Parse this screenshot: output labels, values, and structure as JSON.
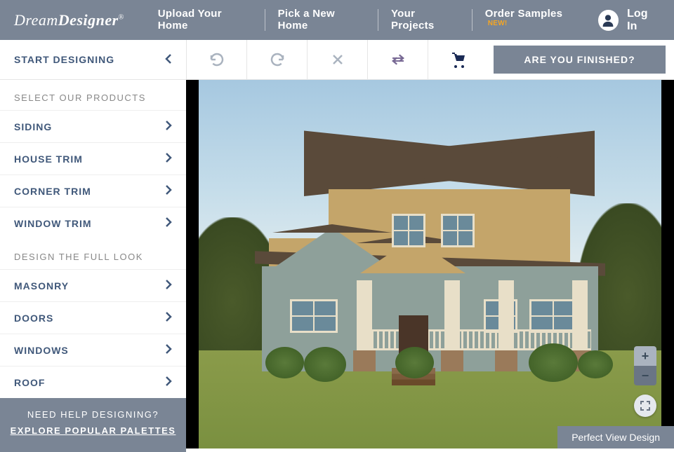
{
  "header": {
    "logo_pre": "Dream",
    "logo_post": "Designer",
    "nav": [
      "Upload Your Home",
      "Pick a New Home",
      "Your Projects",
      "Order Samples"
    ],
    "new_badge": "NEW!",
    "login": "Log In"
  },
  "subheader": {
    "title": "START DESIGNING",
    "finished": "ARE YOU FINISHED?"
  },
  "sidebar": {
    "section1_title": "SELECT OUR PRODUCTS",
    "section1_items": [
      "SIDING",
      "HOUSE TRIM",
      "CORNER TRIM",
      "WINDOW TRIM"
    ],
    "section2_title": "DESIGN THE FULL LOOK",
    "section2_items": [
      "MASONRY",
      "DOORS",
      "WINDOWS",
      "ROOF"
    ],
    "help_title": "NEED HELP DESIGNING?",
    "help_link": "EXPLORE POPULAR PALETTES"
  },
  "canvas": {
    "zoom_in": "+",
    "zoom_out": "−",
    "perfect_view": "Perfect View Design"
  }
}
